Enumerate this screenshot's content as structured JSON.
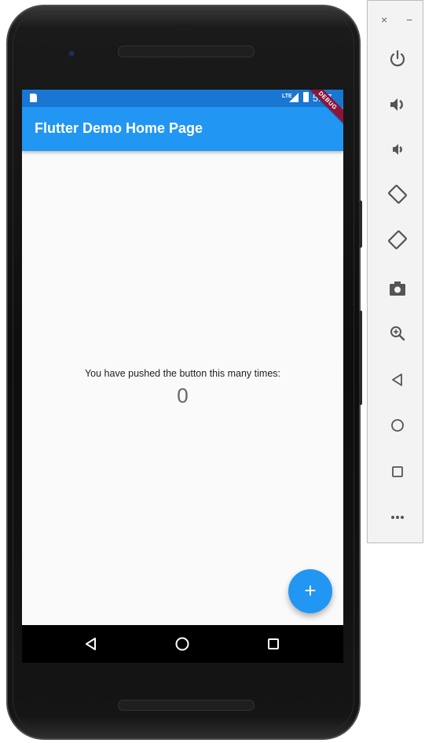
{
  "device": {
    "status_bar": {
      "time": "5:17",
      "network": "LTE"
    },
    "debug_banner": "DEBUG"
  },
  "app": {
    "title": "Flutter Demo Home Page",
    "counter_label": "You have pushed the button this many times:",
    "counter_value": "0",
    "fab_label": "+",
    "colors": {
      "primary": "#2196f3",
      "primary_dark": "#1976d2",
      "background": "#fafafa"
    }
  },
  "android_nav": [
    "back-icon",
    "home-icon",
    "recents-icon"
  ],
  "emulator_toolbar": {
    "window_controls": {
      "close": "×",
      "minimize": "−"
    },
    "buttons": [
      "power-icon",
      "volume-up-icon",
      "volume-down-icon",
      "rotate-left-icon",
      "rotate-right-icon",
      "camera-icon",
      "zoom-icon",
      "back-icon",
      "home-icon",
      "overview-icon",
      "more-icon"
    ]
  }
}
